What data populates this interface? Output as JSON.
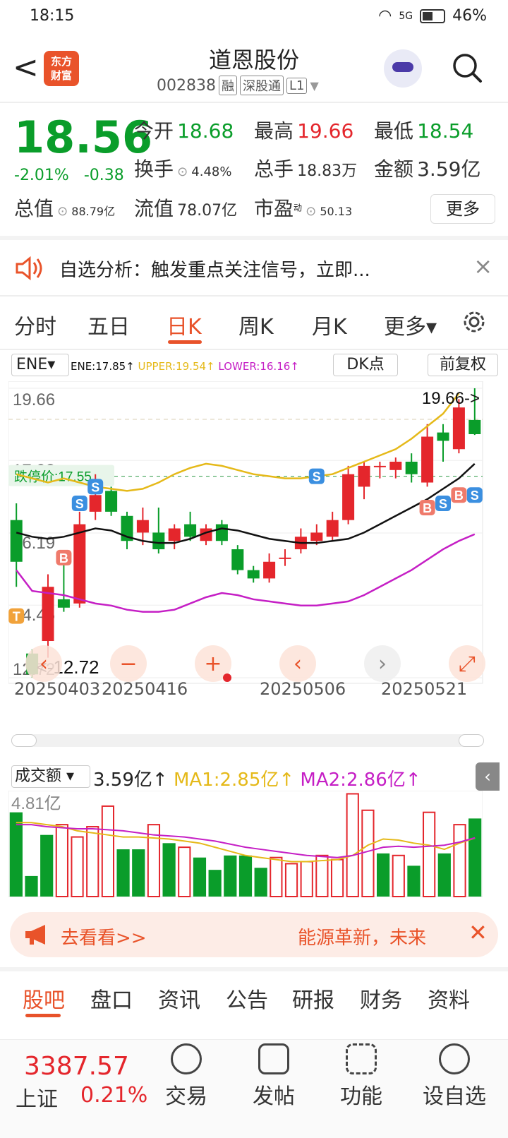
{
  "status": {
    "time": "18:15",
    "network": "5G",
    "battery": "46%"
  },
  "header": {
    "back_symbol": "<",
    "logo_line1": "东方",
    "logo_line2": "财富",
    "title": "道恩股份",
    "code": "002838",
    "tag1": "融",
    "tag2": "深股通",
    "tag3": "L1"
  },
  "quote": {
    "price": "18.56",
    "pct": "-2.01%",
    "change": "-0.38",
    "open_label": "今开",
    "open": "18.68",
    "high_label": "最高",
    "high": "19.66",
    "low_label": "最低",
    "low": "18.54",
    "turnover_label": "换手",
    "turnover": "4.48%",
    "volume_label": "总手",
    "volume": "18.83万",
    "amount_label": "金额",
    "amount": "3.59亿",
    "mktcap_label": "总值",
    "mktcap": "88.79亿",
    "float_label": "流值",
    "float": "78.07亿",
    "pe_label": "市盈",
    "pe_sup": "动",
    "pe": "50.13",
    "more": "更多"
  },
  "banner": {
    "text": "自选分析：触发重点关注信号，立即...",
    "close": "×"
  },
  "tabs": [
    "分时",
    "五日",
    "日K",
    "周K",
    "月K",
    "更多▾"
  ],
  "indicator": {
    "selected": "ENE▾",
    "ene": "ENE:17.85↑",
    "upper": "UPPER:19.54↑",
    "lower": "LOWER:16.16↑",
    "dk": "DK点",
    "fq": "前复权"
  },
  "colors": {
    "up": "#e4262c",
    "down": "#0a9d2a",
    "upper": "#e5b919",
    "lower": "#c51fc5",
    "ene": "#111111",
    "accent": "#e8522a"
  },
  "chart_data": [
    {
      "type": "candlestick",
      "y_ticks": [
        "19.66",
        "17.93",
        "16.19",
        "14.46",
        "12.72"
      ],
      "ylim": [
        12.72,
        19.66
      ],
      "x_ticks": [
        "20250403",
        "20250416",
        "20250506",
        "20250521"
      ],
      "limit_down_label": "跌停价:17.55",
      "limit_down": 17.55,
      "high_annotation": "19.66->",
      "low_annotation": "<-12.72",
      "candles": [
        {
          "o": 16.5,
          "c": 15.5,
          "h": 16.9,
          "l": 14.9
        },
        {
          "o": 13.3,
          "c": 12.8,
          "h": 13.4,
          "l": 12.72
        },
        {
          "o": 13.6,
          "c": 14.9,
          "h": 15.2,
          "l": 13.2
        },
        {
          "o": 14.6,
          "c": 14.4,
          "h": 15.7,
          "l": 14.3
        },
        {
          "o": 14.5,
          "c": 16.4,
          "h": 16.7,
          "l": 14.4
        },
        {
          "o": 16.7,
          "c": 17.1,
          "h": 17.6,
          "l": 16.5
        },
        {
          "o": 17.2,
          "c": 16.7,
          "h": 17.3,
          "l": 16.6
        },
        {
          "o": 16.6,
          "c": 16.0,
          "h": 16.7,
          "l": 15.8
        },
        {
          "o": 16.2,
          "c": 16.5,
          "h": 16.8,
          "l": 15.9
        },
        {
          "o": 16.2,
          "c": 15.8,
          "h": 16.8,
          "l": 15.7
        },
        {
          "o": 16.0,
          "c": 16.3,
          "h": 16.4,
          "l": 15.8
        },
        {
          "o": 16.4,
          "c": 16.1,
          "h": 16.7,
          "l": 16.0
        },
        {
          "o": 16.0,
          "c": 16.3,
          "h": 16.4,
          "l": 15.9
        },
        {
          "o": 16.4,
          "c": 16.0,
          "h": 16.5,
          "l": 15.9
        },
        {
          "o": 15.8,
          "c": 15.3,
          "h": 15.9,
          "l": 15.2
        },
        {
          "o": 15.3,
          "c": 15.1,
          "h": 15.4,
          "l": 15.0
        },
        {
          "o": 15.1,
          "c": 15.5,
          "h": 15.7,
          "l": 15.0
        },
        {
          "o": 15.6,
          "c": 15.6,
          "h": 15.8,
          "l": 15.4
        },
        {
          "o": 15.8,
          "c": 16.1,
          "h": 16.3,
          "l": 15.7
        },
        {
          "o": 16.0,
          "c": 16.2,
          "h": 16.4,
          "l": 15.9
        },
        {
          "o": 16.1,
          "c": 16.5,
          "h": 16.7,
          "l": 16.0
        },
        {
          "o": 16.5,
          "c": 17.6,
          "h": 17.8,
          "l": 16.4
        },
        {
          "o": 17.3,
          "c": 17.8,
          "h": 17.9,
          "l": 17.0
        },
        {
          "o": 17.8,
          "c": 17.8,
          "h": 17.9,
          "l": 17.5
        },
        {
          "o": 17.7,
          "c": 17.9,
          "h": 18.0,
          "l": 17.5
        },
        {
          "o": 17.9,
          "c": 17.6,
          "h": 18.1,
          "l": 17.4
        },
        {
          "o": 17.4,
          "c": 18.5,
          "h": 18.8,
          "l": 17.3
        },
        {
          "o": 18.6,
          "c": 18.4,
          "h": 18.8,
          "l": 17.9
        },
        {
          "o": 18.2,
          "c": 19.2,
          "h": 19.4,
          "l": 18.1
        },
        {
          "o": 18.9,
          "c": 18.56,
          "h": 19.66,
          "l": 18.54
        }
      ],
      "upper_line": [
        19.9,
        17.6,
        17.5,
        17.4,
        17.5,
        17.4,
        17.3,
        17.25,
        17.2,
        17.25,
        17.4,
        17.6,
        17.75,
        17.85,
        17.8,
        17.7,
        17.6,
        17.55,
        17.5,
        17.5,
        17.55,
        17.6,
        17.75,
        17.9,
        18.05,
        18.2,
        18.45,
        18.75,
        19.05,
        19.54
      ],
      "ene_line": [
        16.2,
        16.1,
        16.05,
        16.1,
        16.2,
        16.3,
        16.25,
        16.1,
        16.0,
        15.95,
        15.95,
        16.05,
        16.2,
        16.3,
        16.25,
        16.15,
        16.05,
        16.0,
        15.95,
        15.95,
        16.0,
        16.05,
        16.2,
        16.4,
        16.6,
        16.8,
        17.0,
        17.25,
        17.5,
        17.85
      ],
      "lower_line": [
        15.3,
        14.8,
        14.75,
        14.7,
        14.6,
        14.5,
        14.45,
        14.35,
        14.3,
        14.3,
        14.35,
        14.5,
        14.65,
        14.75,
        14.7,
        14.6,
        14.55,
        14.5,
        14.45,
        14.45,
        14.5,
        14.55,
        14.7,
        14.9,
        15.1,
        15.3,
        15.55,
        15.8,
        16.0,
        16.16
      ],
      "signals": [
        {
          "label": "T",
          "i": 0,
          "v": 14.2
        },
        {
          "label": "B",
          "i": 3,
          "v": 15.6
        },
        {
          "label": "S",
          "i": 4,
          "v": 16.9
        },
        {
          "label": "S",
          "i": 5,
          "v": 17.3
        },
        {
          "label": "S",
          "i": 19,
          "v": 17.55
        },
        {
          "label": "B",
          "i": 26,
          "v": 16.8
        },
        {
          "label": "S",
          "i": 27,
          "v": 16.9
        },
        {
          "label": "B",
          "i": 28,
          "v": 17.1
        },
        {
          "label": "S",
          "i": 29,
          "v": 17.1
        }
      ]
    },
    {
      "type": "bar",
      "title": "成交额",
      "y_tick": "4.81亿",
      "ylim": [
        0,
        4.81
      ],
      "values": [
        4.1,
        1.0,
        3.0,
        3.5,
        2.9,
        3.4,
        4.4,
        2.3,
        2.3,
        3.5,
        2.6,
        2.4,
        1.9,
        1.3,
        2.0,
        2.0,
        1.4,
        1.9,
        1.6,
        1.7,
        2.0,
        1.8,
        5.0,
        4.2,
        2.1,
        2.0,
        1.5,
        4.1,
        2.1,
        3.5,
        3.8
      ],
      "up": [
        false,
        false,
        false,
        true,
        true,
        true,
        true,
        false,
        false,
        true,
        false,
        true,
        false,
        false,
        false,
        false,
        false,
        true,
        true,
        true,
        true,
        true,
        true,
        true,
        false,
        true,
        false,
        true,
        false,
        true,
        false
      ],
      "ma1": [
        3.6,
        3.6,
        3.5,
        3.4,
        3.2,
        3.1,
        3.0,
        2.9,
        2.9,
        2.85,
        2.8,
        2.7,
        2.6,
        2.4,
        2.2,
        2.0,
        1.9,
        1.8,
        1.7,
        1.7,
        1.75,
        1.8,
        2.0,
        2.5,
        2.8,
        2.75,
        2.6,
        2.5,
        2.3,
        2.6,
        2.85
      ],
      "ma2": [
        3.5,
        3.5,
        3.4,
        3.35,
        3.3,
        3.3,
        3.25,
        3.2,
        3.1,
        3.0,
        2.95,
        2.9,
        2.8,
        2.7,
        2.55,
        2.4,
        2.3,
        2.2,
        2.1,
        2.0,
        1.95,
        1.9,
        2.0,
        2.2,
        2.4,
        2.45,
        2.4,
        2.45,
        2.5,
        2.65,
        2.86
      ],
      "ma1_label": "MA1:2.85亿↑",
      "ma2_label": "MA2:2.86亿↑",
      "current": "3.59亿↑",
      "selected": "成交额 ▾"
    }
  ],
  "ad": {
    "left": "去看看>>",
    "right": "能源革新，未来",
    "close": "✕"
  },
  "bottom_tabs": [
    "股吧",
    "盘口",
    "资讯",
    "公告",
    "研报",
    "财务",
    "资料"
  ],
  "footer": {
    "index_value": "3387.57",
    "index_name": "上证",
    "index_pct": "0.21%",
    "buttons": [
      "交易",
      "发帖",
      "功能",
      "设自选"
    ]
  }
}
